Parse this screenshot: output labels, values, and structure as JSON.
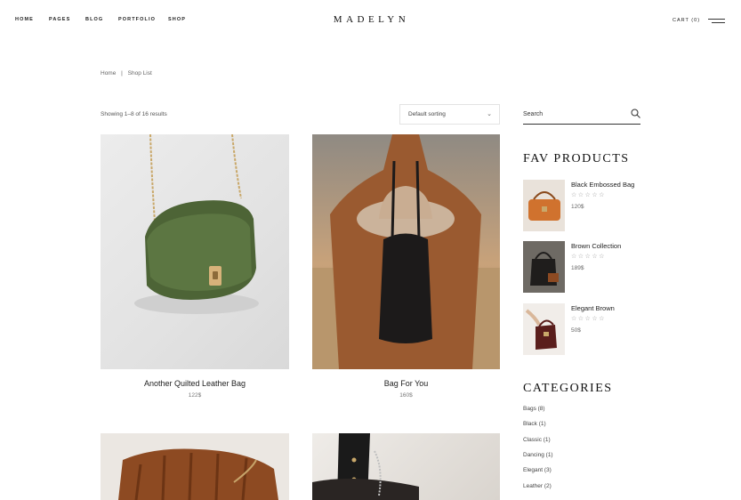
{
  "header": {
    "nav": [
      {
        "label": "HOME"
      },
      {
        "label": "PAGES"
      },
      {
        "label": "BLOG"
      },
      {
        "label": "PORTFOLIO"
      },
      {
        "label": "SHOP"
      }
    ],
    "logo": "MADELYN",
    "cart_label": "CART (0)"
  },
  "breadcrumb": {
    "home": "Home",
    "separator": "|",
    "current": "Shop List"
  },
  "toolbar": {
    "result_count": "Showing 1–8 of 16 results",
    "sorting_value": "Default sorting"
  },
  "products": [
    {
      "title": "Another Quilted Leather Bag",
      "price": "122$",
      "image": "green-quilted-shoulder-bag"
    },
    {
      "title": "Bag For You",
      "price": "160$",
      "image": "woman-with-black-bucket-bag"
    },
    {
      "title": "",
      "price": "",
      "image": "brown-woven-leather-bag"
    },
    {
      "title": "",
      "price": "",
      "image": "black-studded-bag"
    }
  ],
  "sidebar": {
    "search_placeholder": "Search",
    "fav_heading": "FAV PRODUCTS",
    "fav_products": [
      {
        "name": "Black Embossed Bag",
        "stars": "☆☆☆☆☆",
        "price": "120$"
      },
      {
        "name": "Brown Collection",
        "stars": "☆☆☆☆☆",
        "price": "189$"
      },
      {
        "name": "Elegant Brown",
        "stars": "☆☆☆☆☆",
        "price": "50$"
      }
    ],
    "categories_heading": "CATEGORIES",
    "categories": [
      {
        "label": "Bags (8)"
      },
      {
        "label": "Black (1)"
      },
      {
        "label": "Classic (1)"
      },
      {
        "label": "Dancing (1)"
      },
      {
        "label": "Elegant (3)"
      },
      {
        "label": "Leather (2)"
      }
    ]
  },
  "colors": {
    "accent": "#222222",
    "muted": "#777777",
    "border": "#e3e3e3"
  }
}
